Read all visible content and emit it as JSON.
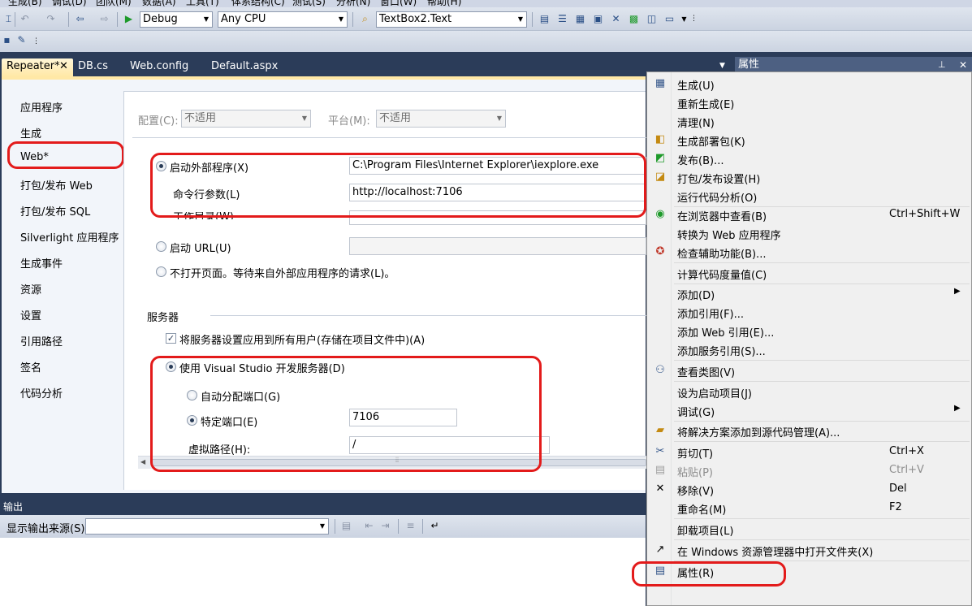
{
  "menubar": {
    "items": [
      "生成(B)",
      "调试(D)",
      "团队(M)",
      "数据(A)",
      "工具(T)",
      "体系结构(C)",
      "测试(S)",
      "分析(N)",
      "窗口(W)",
      "帮助(H)"
    ]
  },
  "toolbar": {
    "config_value": "Debug",
    "platform_value": "Any CPU",
    "find_value": "TextBox2.Text"
  },
  "doc_tabs": [
    {
      "label": "Repeater*"
    },
    {
      "label": "DB.cs"
    },
    {
      "label": "Web.config"
    },
    {
      "label": "Default.aspx"
    }
  ],
  "left_nav": [
    "应用程序",
    "生成",
    "Web*",
    "打包/发布 Web",
    "打包/发布 SQL",
    "Silverlight 应用程序",
    "生成事件",
    "资源",
    "设置",
    "引用路径",
    "签名",
    "代码分析"
  ],
  "web_page": {
    "config_label": "配置(C):",
    "config_value": "不适用",
    "platform_label": "平台(M):",
    "platform_value": "不适用",
    "start_external_label": "启动外部程序(X)",
    "start_external_value": "C:\\Program Files\\Internet Explorer\\iexplore.exe",
    "cmd_args_label": "命令行参数(L)",
    "cmd_args_value": "http://localhost:7106",
    "work_dir_label": "工作目录(W)",
    "start_url_label": "启动 URL(U)",
    "no_open_label": "不打开页面。等待来自外部应用程序的请求(L)。",
    "servers_heading": "服务器",
    "apply_all_label": "将服务器设置应用到所有用户(存储在项目文件中)(A)",
    "use_vs_label": "使用 Visual Studio 开发服务器(D)",
    "auto_port_label": "自动分配端口(G)",
    "specific_port_label": "特定端口(E)",
    "specific_port_value": "7106",
    "virtual_path_label": "虚拟路径(H):",
    "virtual_path_value": "/"
  },
  "output": {
    "title": "输出",
    "source_label": "显示输出来源(S):"
  },
  "properties": {
    "title": "属性"
  },
  "context_menu": [
    {
      "label": "生成(U)",
      "icon": "build-icon"
    },
    {
      "label": "重新生成(E)"
    },
    {
      "label": "清理(N)"
    },
    {
      "label": "生成部署包(K)",
      "icon": "package-icon"
    },
    {
      "label": "发布(B)...",
      "icon": "publish-icon"
    },
    {
      "label": "打包/发布设置(H)",
      "icon": "settings-icon"
    },
    {
      "label": "运行代码分析(O)"
    },
    {
      "label": "在浏览器中查看(B)",
      "shortcut": "Ctrl+Shift+W",
      "icon": "browser-icon"
    },
    {
      "label": "转换为 Web 应用程序"
    },
    {
      "label": "检查辅助功能(B)...",
      "icon": "accessibility-icon"
    },
    {
      "label": "计算代码度量值(C)"
    },
    {
      "label": "添加(D)",
      "submenu": true
    },
    {
      "label": "添加引用(F)..."
    },
    {
      "label": "添加 Web 引用(E)..."
    },
    {
      "label": "添加服务引用(S)..."
    },
    {
      "label": "查看类图(V)",
      "icon": "class-diagram-icon"
    },
    {
      "label": "设为启动项目(J)"
    },
    {
      "label": "调试(G)",
      "submenu": true
    },
    {
      "label": "将解决方案添加到源代码管理(A)...",
      "icon": "source-control-icon"
    },
    {
      "label": "剪切(T)",
      "shortcut": "Ctrl+X",
      "icon": "cut-icon"
    },
    {
      "label": "粘贴(P)",
      "shortcut": "Ctrl+V",
      "disabled": true,
      "icon": "paste-icon"
    },
    {
      "label": "移除(V)",
      "shortcut": "Del",
      "icon": "remove-icon"
    },
    {
      "label": "重命名(M)",
      "shortcut": "F2"
    },
    {
      "label": "卸载项目(L)"
    },
    {
      "label": "在 Windows 资源管理器中打开文件夹(X)",
      "icon": "open-folder-icon"
    },
    {
      "label": "属性(R)",
      "icon": "properties-icon"
    }
  ],
  "colors": {
    "highlight_red": "#e31b1b",
    "tab_active": "#ffe8a6",
    "chrome_dark": "#2b3c59"
  }
}
